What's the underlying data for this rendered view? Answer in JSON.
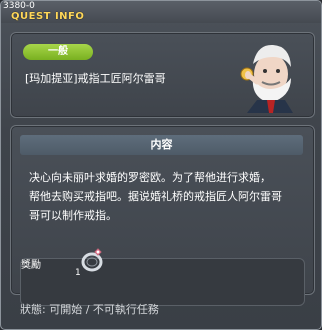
{
  "window": {
    "quest_id": "3380-0",
    "title": "QUEST INFO"
  },
  "quest": {
    "category": "一般",
    "name": "[玛加提亚]戒指工匠阿尔雷哥"
  },
  "content": {
    "header": "内容",
    "description": "决心向未丽叶求婚的罗密欧。为了帮他进行求婚，\n帮他去购买戒指吧。据说婚礼桥的戒指匠人阿尔雷哥\n哥可以制作戒指。"
  },
  "reward": {
    "label": "獎勵",
    "item_icon": "ring-icon",
    "quantity": "1"
  },
  "status": {
    "text": "狀態: 可開始 / 不可執行任務"
  },
  "colors": {
    "title": "#ffd85a",
    "badge": "#8ec33a",
    "header_bar": "#566574"
  }
}
